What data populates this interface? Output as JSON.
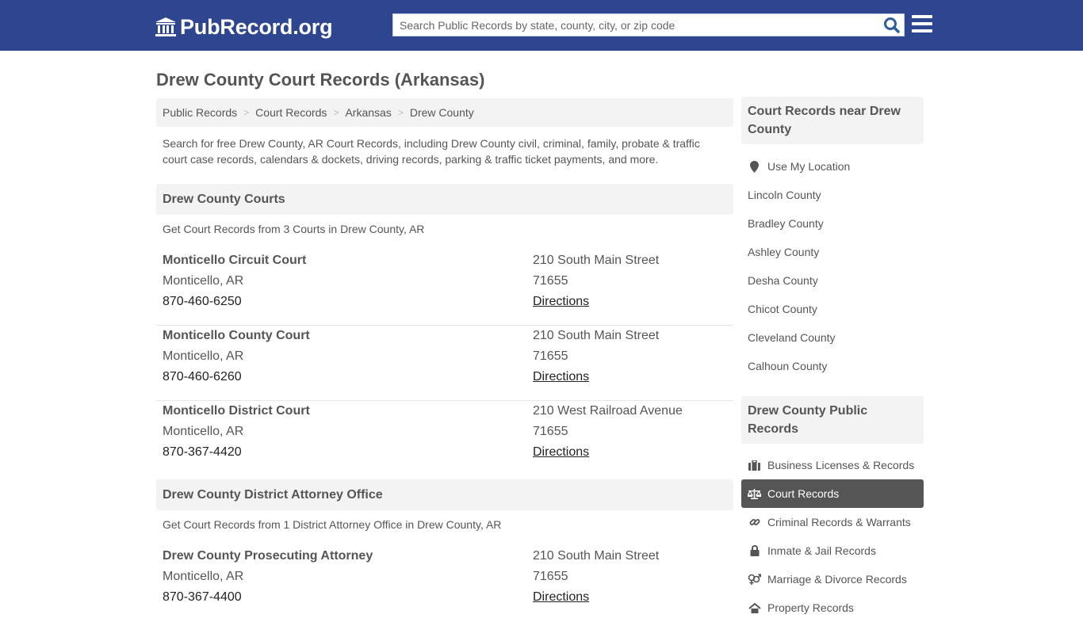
{
  "header": {
    "logo_text": "PubRecord.org",
    "search_placeholder": "Search Public Records by state, county, city, or zip code",
    "search_value": ""
  },
  "page_title": "Drew County Court Records (Arkansas)",
  "breadcrumb": [
    {
      "label": "Public Records"
    },
    {
      "label": "Court Records"
    },
    {
      "label": "Arkansas"
    },
    {
      "label": "Drew County"
    }
  ],
  "intro": "Search for free Drew County, AR Court Records, including Drew County civil, criminal, family, probate & traffic court case records, calendars & dockets, driving records, parking & traffic ticket payments, and more.",
  "sections": [
    {
      "title": "Drew County Courts",
      "subtitle": "Get Court Records from 3 Courts in Drew County, AR",
      "records": [
        {
          "name": "Monticello Circuit Court",
          "city": "Monticello, AR",
          "phone": "870-460-6250",
          "address": "210 South Main Street",
          "zip": "71655",
          "directions": "Directions"
        },
        {
          "name": "Monticello County Court",
          "city": "Monticello, AR",
          "phone": "870-460-6260",
          "address": "210 South Main Street",
          "zip": "71655",
          "directions": "Directions"
        },
        {
          "name": "Monticello District Court",
          "city": "Monticello, AR",
          "phone": "870-367-4420",
          "address": "210 West Railroad Avenue",
          "zip": "71655",
          "directions": "Directions"
        }
      ]
    },
    {
      "title": "Drew County District Attorney Office",
      "subtitle": "Get Court Records from 1 District Attorney Office in Drew County, AR",
      "records": [
        {
          "name": "Drew County Prosecuting Attorney",
          "city": "Monticello, AR",
          "phone": "870-367-4400",
          "address": "210 South Main Street",
          "zip": "71655",
          "directions": "Directions"
        }
      ]
    }
  ],
  "sidebar": {
    "nearby": {
      "title": "Court Records near Drew County",
      "use_location": "Use My Location",
      "counties": [
        "Lincoln County",
        "Bradley County",
        "Ashley County",
        "Desha County",
        "Chicot County",
        "Cleveland County",
        "Calhoun County"
      ]
    },
    "public_records": {
      "title": "Drew County Public Records",
      "items": [
        {
          "label": "Business Licenses & Records",
          "icon": "briefcase-icon",
          "active": false
        },
        {
          "label": "Court Records",
          "icon": "scales-icon",
          "active": true
        },
        {
          "label": "Criminal Records & Warrants",
          "icon": "link-icon",
          "active": false
        },
        {
          "label": "Inmate & Jail Records",
          "icon": "lock-icon",
          "active": false
        },
        {
          "label": "Marriage & Divorce Records",
          "icon": "gender-icon",
          "active": false
        },
        {
          "label": "Property Records",
          "icon": "home-icon",
          "active": false
        }
      ]
    }
  },
  "colors": {
    "header_bg": "#2e4690",
    "search_icon": "#2e5f9a",
    "active_item_bg": "#555555"
  }
}
